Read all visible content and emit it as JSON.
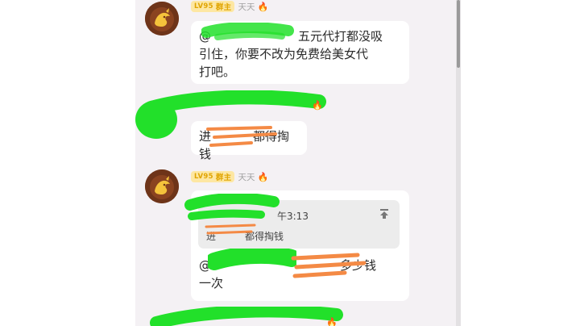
{
  "messages": [
    {
      "level": "LV95",
      "role": "群主",
      "name": "天天",
      "text_lines": [
        "@",
        "五元代打都没吸",
        "引住，你要不改为免费给美女代",
        "打吧。"
      ]
    },
    {
      "text_lines": [
        "进",
        "都得掏钱"
      ]
    },
    {
      "level": "LV95",
      "role": "群主",
      "name": "天天",
      "quote_time": "午3:13",
      "quote_text_start": "进",
      "quote_text_end": "都得掏钱",
      "text_lines": [
        "@",
        "多少钱",
        "一次"
      ]
    }
  ],
  "colors": {
    "redact_green": "#22e02a",
    "redact_orange": "#f48a45",
    "badge_bg": "#fde7a3",
    "badge_text": "#e0a400"
  },
  "icons": [
    "avatar-dragon-icon",
    "fire-icon",
    "scroll-to-top-icon"
  ]
}
